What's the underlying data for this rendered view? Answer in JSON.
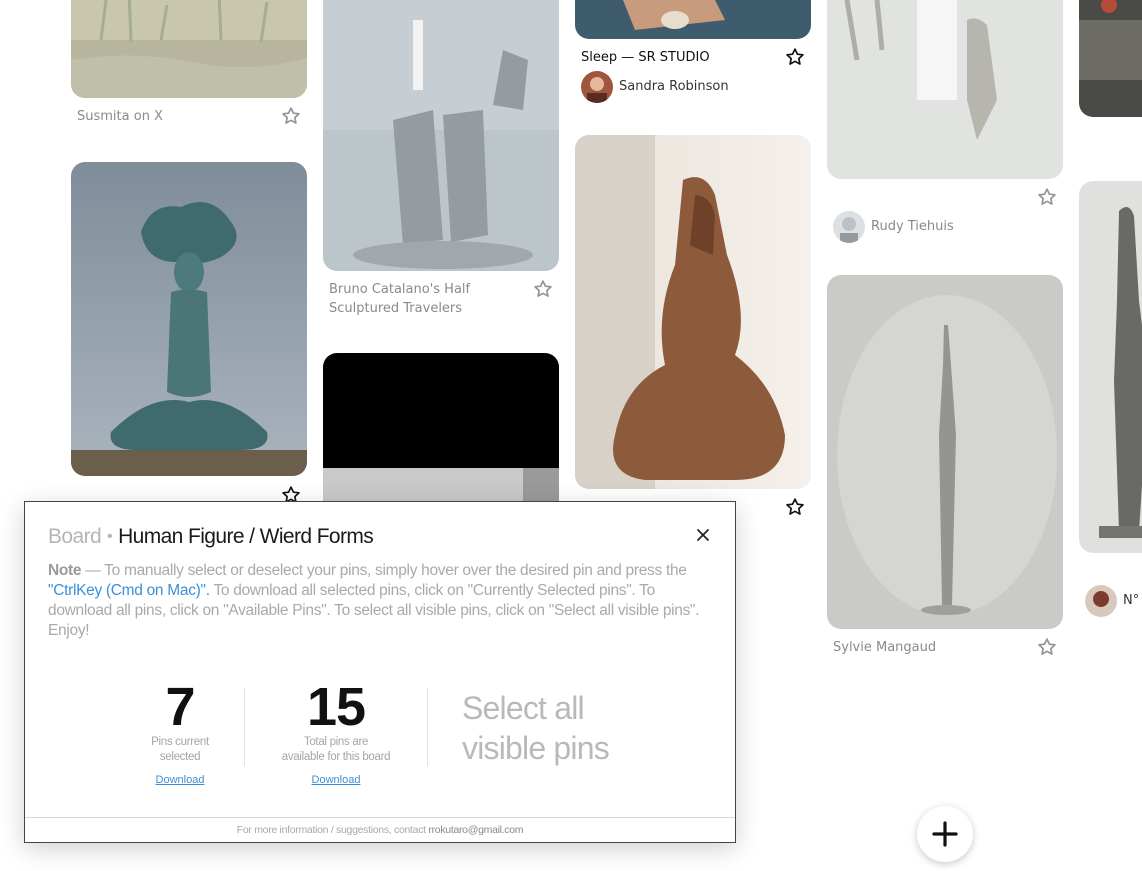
{
  "pins": {
    "col1_top_title": "Susmita on X",
    "col2_top_title": "Bruno Catalano's Half Sculptured Travelers",
    "col3_top_title": "Sleep — SR STUDIO",
    "col3_top_author": "Sandra Robinson",
    "col4_top_author": "Rudy Tiehuis",
    "col4_bottom_author": "Sylvie Mangaud",
    "col5_author": "N°"
  },
  "modal": {
    "board_label": "Board",
    "separator": "•",
    "board_name": "Human Figure / Wierd Forms",
    "note_label": "Note",
    "note_part1": " — To manually select or deselect your pins, simply hover over the desired pin and press the ",
    "note_key": "\"CtrlKey (Cmd on Mac)\".",
    "note_part2": " To download all selected pins, click on \"Currently Selected pins\". To download all pins, click on \"Available Pins\". To select all visible pins, click on \"Select all visible pins\". Enjoy!",
    "selected_count": "7",
    "selected_label_line1": "Pins current",
    "selected_label_line2": "selected",
    "selected_download": "Download",
    "total_count": "15",
    "total_label_line1": "Total pins are",
    "total_label_line2": "available for this board",
    "total_download": "Download",
    "select_all_line1": "Select all",
    "select_all_line2": "visible pins",
    "footer_text": "For more information / suggestions, contact ",
    "footer_email": "rrokutaro@gmail.com"
  },
  "colors": {
    "link_blue": "#3b8fd6",
    "muted_gray": "#a9a9a9"
  },
  "icons": [
    "star-icon",
    "close-icon",
    "plus-icon"
  ]
}
